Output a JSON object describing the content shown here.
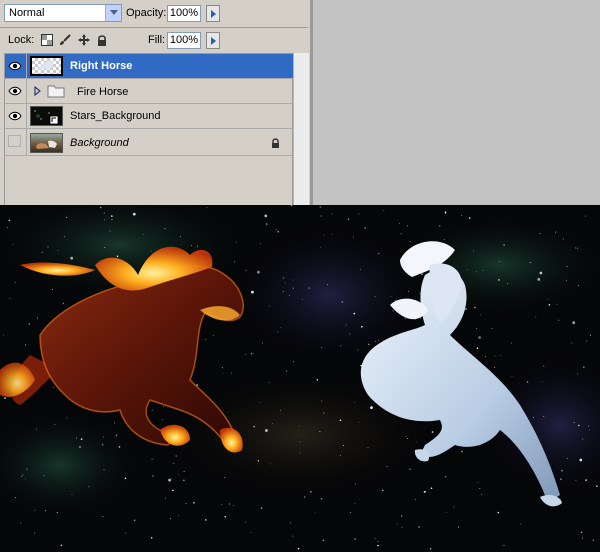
{
  "layers_panel": {
    "blend_mode": "Normal",
    "opacity_label": "Opacity:",
    "opacity_value": "100%",
    "lock_label": "Lock:",
    "fill_label": "Fill:",
    "fill_value": "100%",
    "layers": [
      {
        "name": "Right Horse",
        "visible": true,
        "selected": true,
        "type": "layer"
      },
      {
        "name": "Fire Horse",
        "visible": true,
        "selected": false,
        "type": "group"
      },
      {
        "name": "Stars_Background",
        "visible": true,
        "selected": false,
        "type": "layer"
      },
      {
        "name": "Background",
        "visible": false,
        "selected": false,
        "type": "locked-background"
      }
    ]
  },
  "colors": {
    "panel_bg": "#d4d0c8",
    "selection": "#316ac5",
    "canvas_bg": "#050608",
    "fire": "#ff8a1a",
    "white_horse": "#c9d9ec"
  },
  "icons": [
    "eye-icon",
    "folder-icon",
    "lock-icon",
    "move-icon",
    "brush-icon",
    "transparency-lock-icon",
    "chevron-down-icon",
    "arrow-right-icon"
  ]
}
